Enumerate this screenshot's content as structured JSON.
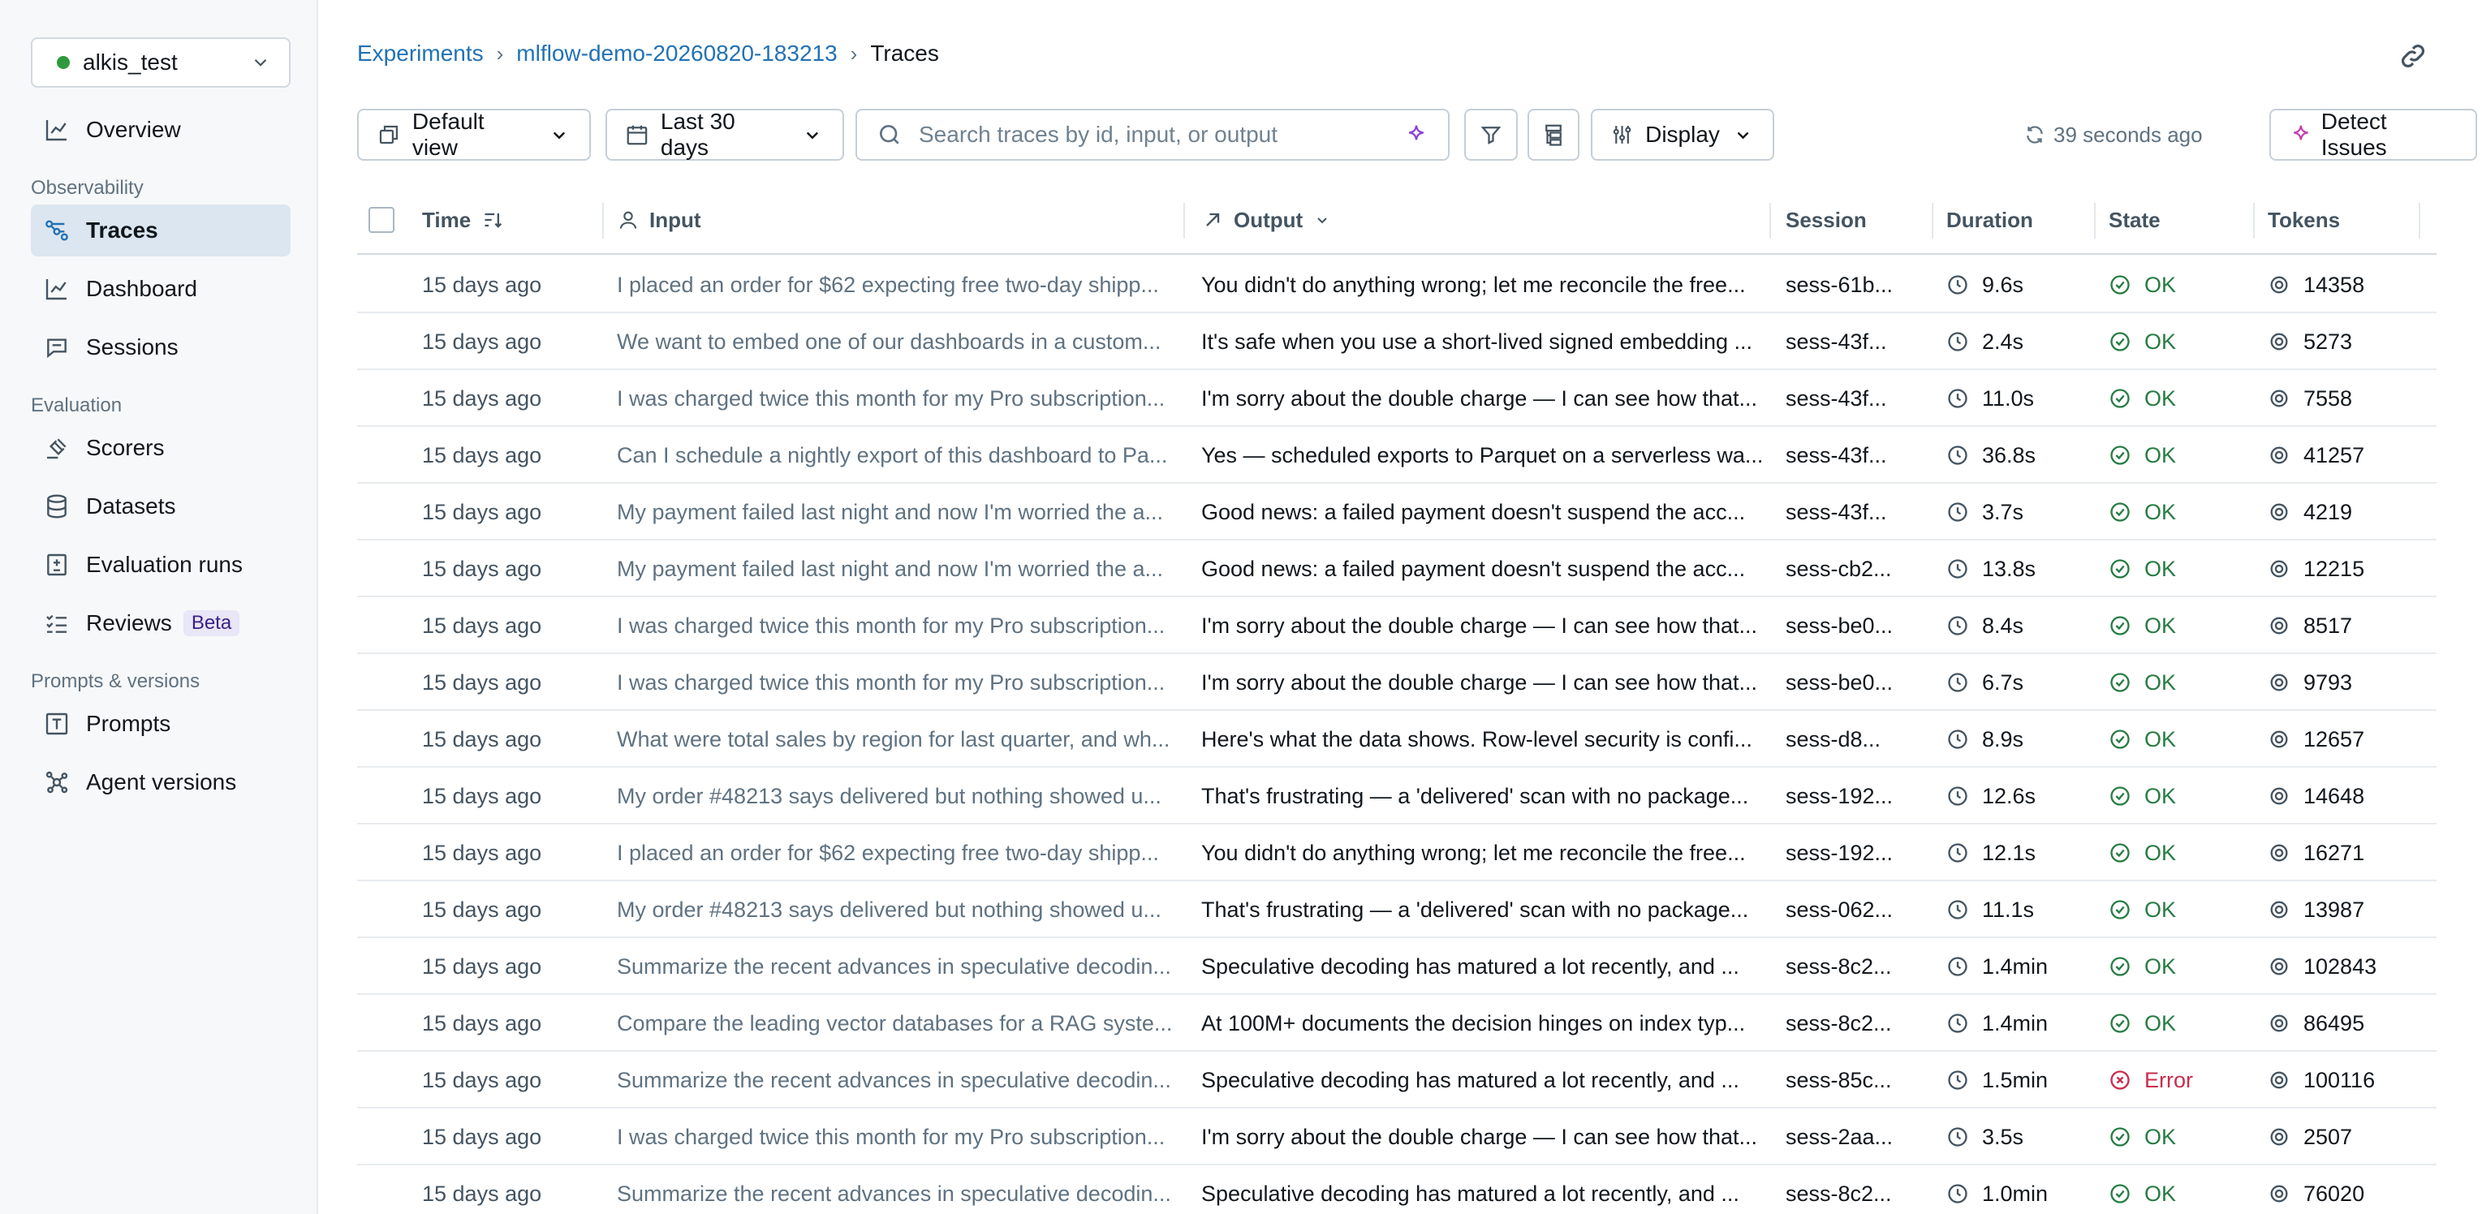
{
  "sidebar": {
    "workspace": "alkis_test",
    "overview": "Overview",
    "groups": {
      "observability": "Observability",
      "evaluation": "Evaluation",
      "prompts_versions": "Prompts & versions"
    },
    "items": {
      "traces": "Traces",
      "dashboard": "Dashboard",
      "sessions": "Sessions",
      "scorers": "Scorers",
      "datasets": "Datasets",
      "evaluation_runs": "Evaluation runs",
      "reviews": "Reviews",
      "reviews_badge": "Beta",
      "prompts": "Prompts",
      "agent_versions": "Agent versions"
    }
  },
  "breadcrumb": {
    "experiments": "Experiments",
    "experiment": "mlflow-demo-20260820-183213",
    "current": "Traces"
  },
  "toolbar": {
    "view": "Default view",
    "range": "Last 30 days",
    "search_placeholder": "Search traces by id, input, or output",
    "display": "Display",
    "refreshed": "39 seconds ago",
    "detect": "Detect Issues"
  },
  "table": {
    "columns": {
      "time": "Time",
      "input": "Input",
      "output": "Output",
      "session": "Session",
      "duration": "Duration",
      "state": "State",
      "tokens": "Tokens"
    },
    "rows": [
      {
        "time": "15 days ago",
        "input": "I placed an order for $62 expecting free two-day shipp...",
        "output": "You didn't do anything wrong; let me reconcile the free...",
        "session": "sess-61b...",
        "duration": "9.6s",
        "state": "OK",
        "tokens": "14358"
      },
      {
        "time": "15 days ago",
        "input": "We want to embed one of our dashboards in a custom...",
        "output": "It's safe when you use a short-lived signed embedding ...",
        "session": "sess-43f...",
        "duration": "2.4s",
        "state": "OK",
        "tokens": "5273"
      },
      {
        "time": "15 days ago",
        "input": "I was charged twice this month for my Pro subscription...",
        "output": "I'm sorry about the double charge — I can see how that...",
        "session": "sess-43f...",
        "duration": "11.0s",
        "state": "OK",
        "tokens": "7558"
      },
      {
        "time": "15 days ago",
        "input": "Can I schedule a nightly export of this dashboard to Pa...",
        "output": "Yes — scheduled exports to Parquet on a serverless wa...",
        "session": "sess-43f...",
        "duration": "36.8s",
        "state": "OK",
        "tokens": "41257"
      },
      {
        "time": "15 days ago",
        "input": "My payment failed last night and now I'm worried the a...",
        "output": "Good news: a failed payment doesn't suspend the acc...",
        "session": "sess-43f...",
        "duration": "3.7s",
        "state": "OK",
        "tokens": "4219"
      },
      {
        "time": "15 days ago",
        "input": "My payment failed last night and now I'm worried the a...",
        "output": "Good news: a failed payment doesn't suspend the acc...",
        "session": "sess-cb2...",
        "duration": "13.8s",
        "state": "OK",
        "tokens": "12215"
      },
      {
        "time": "15 days ago",
        "input": "I was charged twice this month for my Pro subscription...",
        "output": "I'm sorry about the double charge — I can see how that...",
        "session": "sess-be0...",
        "duration": "8.4s",
        "state": "OK",
        "tokens": "8517"
      },
      {
        "time": "15 days ago",
        "input": "I was charged twice this month for my Pro subscription...",
        "output": "I'm sorry about the double charge — I can see how that...",
        "session": "sess-be0...",
        "duration": "6.7s",
        "state": "OK",
        "tokens": "9793"
      },
      {
        "time": "15 days ago",
        "input": "What were total sales by region for last quarter, and wh...",
        "output": "Here's what the data shows. Row-level security is confi...",
        "session": "sess-d8...",
        "duration": "8.9s",
        "state": "OK",
        "tokens": "12657"
      },
      {
        "time": "15 days ago",
        "input": "My order #48213 says delivered but nothing showed u...",
        "output": "That's frustrating — a 'delivered' scan with no package...",
        "session": "sess-192...",
        "duration": "12.6s",
        "state": "OK",
        "tokens": "14648"
      },
      {
        "time": "15 days ago",
        "input": "I placed an order for $62 expecting free two-day shipp...",
        "output": "You didn't do anything wrong; let me reconcile the free...",
        "session": "sess-192...",
        "duration": "12.1s",
        "state": "OK",
        "tokens": "16271"
      },
      {
        "time": "15 days ago",
        "input": "My order #48213 says delivered but nothing showed u...",
        "output": "That's frustrating — a 'delivered' scan with no package...",
        "session": "sess-062...",
        "duration": "11.1s",
        "state": "OK",
        "tokens": "13987"
      },
      {
        "time": "15 days ago",
        "input": "Summarize the recent advances in speculative decodin...",
        "output": "Speculative decoding has matured a lot recently, and ...",
        "session": "sess-8c2...",
        "duration": "1.4min",
        "state": "OK",
        "tokens": "102843"
      },
      {
        "time": "15 days ago",
        "input": "Compare the leading vector databases for a RAG syste...",
        "output": "At 100M+ documents the decision hinges on index typ...",
        "session": "sess-8c2...",
        "duration": "1.4min",
        "state": "OK",
        "tokens": "86495"
      },
      {
        "time": "15 days ago",
        "input": "Summarize the recent advances in speculative decodin...",
        "output": "Speculative decoding has matured a lot recently, and ...",
        "session": "sess-85c...",
        "duration": "1.5min",
        "state": "Error",
        "tokens": "100116"
      },
      {
        "time": "15 days ago",
        "input": "I was charged twice this month for my Pro subscription...",
        "output": "I'm sorry about the double charge — I can see how that...",
        "session": "sess-2aa...",
        "duration": "3.5s",
        "state": "OK",
        "tokens": "2507"
      },
      {
        "time": "15 days ago",
        "input": "Summarize the recent advances in speculative decodin...",
        "output": "Speculative decoding has matured a lot recently, and ...",
        "session": "sess-8c2...",
        "duration": "1.0min",
        "state": "OK",
        "tokens": "76020"
      }
    ]
  },
  "colors": {
    "link": "#2272b4",
    "ok": "#277c43",
    "error": "#c82d4c",
    "active_nav": "#dce6f0",
    "workspace_dot": "#2e9a3e"
  }
}
